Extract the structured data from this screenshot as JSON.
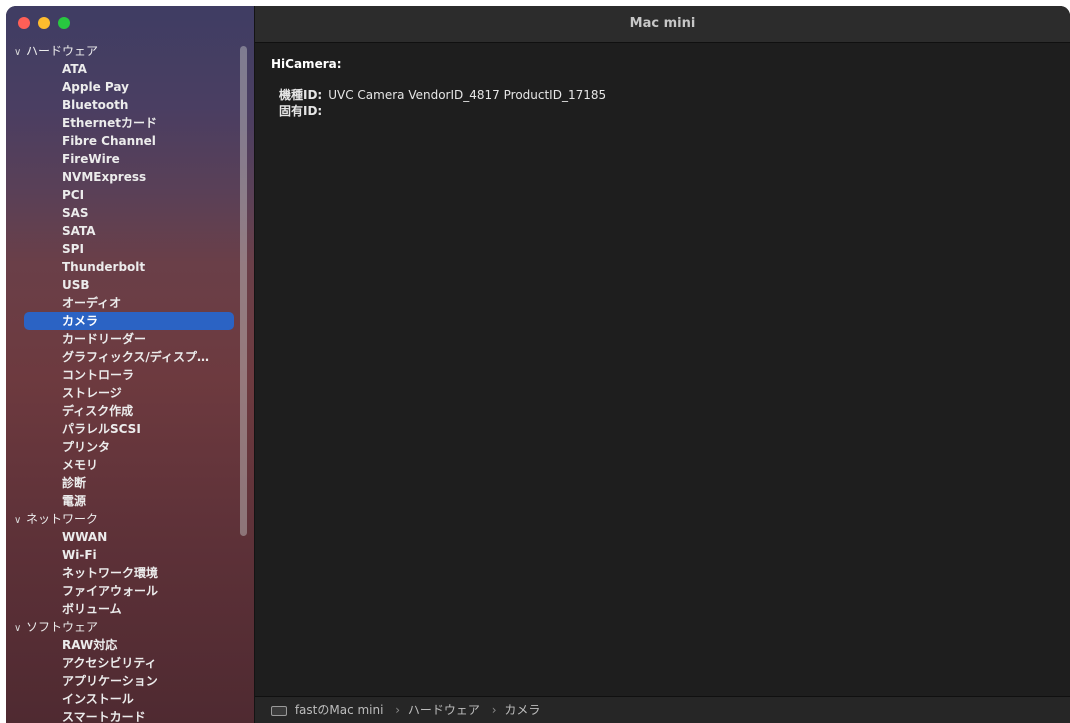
{
  "window": {
    "title": "Mac mini"
  },
  "sidebar": {
    "rows": [
      {
        "type": "section",
        "label": "ハードウェア"
      },
      {
        "type": "item",
        "label": "ATA"
      },
      {
        "type": "item",
        "label": "Apple Pay"
      },
      {
        "type": "item",
        "label": "Bluetooth"
      },
      {
        "type": "item",
        "label": "Ethernetカード"
      },
      {
        "type": "item",
        "label": "Fibre Channel"
      },
      {
        "type": "item",
        "label": "FireWire"
      },
      {
        "type": "item",
        "label": "NVMExpress"
      },
      {
        "type": "item",
        "label": "PCI"
      },
      {
        "type": "item",
        "label": "SAS"
      },
      {
        "type": "item",
        "label": "SATA"
      },
      {
        "type": "item",
        "label": "SPI"
      },
      {
        "type": "item",
        "label": "Thunderbolt"
      },
      {
        "type": "item",
        "label": "USB"
      },
      {
        "type": "item",
        "label": "オーディオ"
      },
      {
        "type": "item",
        "label": "カメラ",
        "selected": true
      },
      {
        "type": "item",
        "label": "カードリーダー"
      },
      {
        "type": "item",
        "label": "グラフィックス/ディスプ…"
      },
      {
        "type": "item",
        "label": "コントローラ"
      },
      {
        "type": "item",
        "label": "ストレージ"
      },
      {
        "type": "item",
        "label": "ディスク作成"
      },
      {
        "type": "item",
        "label": "パラレルSCSI"
      },
      {
        "type": "item",
        "label": "プリンタ"
      },
      {
        "type": "item",
        "label": "メモリ"
      },
      {
        "type": "item",
        "label": "診断"
      },
      {
        "type": "item",
        "label": "電源"
      },
      {
        "type": "section",
        "label": "ネットワーク"
      },
      {
        "type": "item",
        "label": "WWAN"
      },
      {
        "type": "item",
        "label": "Wi-Fi"
      },
      {
        "type": "item",
        "label": "ネットワーク環境"
      },
      {
        "type": "item",
        "label": "ファイアウォール"
      },
      {
        "type": "item",
        "label": "ボリューム"
      },
      {
        "type": "section",
        "label": "ソフトウェア"
      },
      {
        "type": "item",
        "label": "RAW対応"
      },
      {
        "type": "item",
        "label": "アクセシビリティ"
      },
      {
        "type": "item",
        "label": "アプリケーション"
      },
      {
        "type": "item",
        "label": "インストール"
      },
      {
        "type": "item",
        "label": "スマートカード"
      }
    ]
  },
  "detail": {
    "device_title": "HiCamera:",
    "fields": [
      {
        "key": "機種ID:",
        "value": "UVC Camera VendorID_4817 ProductID_17185"
      },
      {
        "key": "固有ID:",
        "value": ""
      }
    ]
  },
  "pathbar": {
    "segments": [
      "fastのMac mini",
      "ハードウェア",
      "カメラ"
    ],
    "separator": "›"
  },
  "colors": {
    "selection": "#2b63c4",
    "close": "#ff5f57",
    "minimize": "#febc2e",
    "zoom": "#28c840"
  }
}
